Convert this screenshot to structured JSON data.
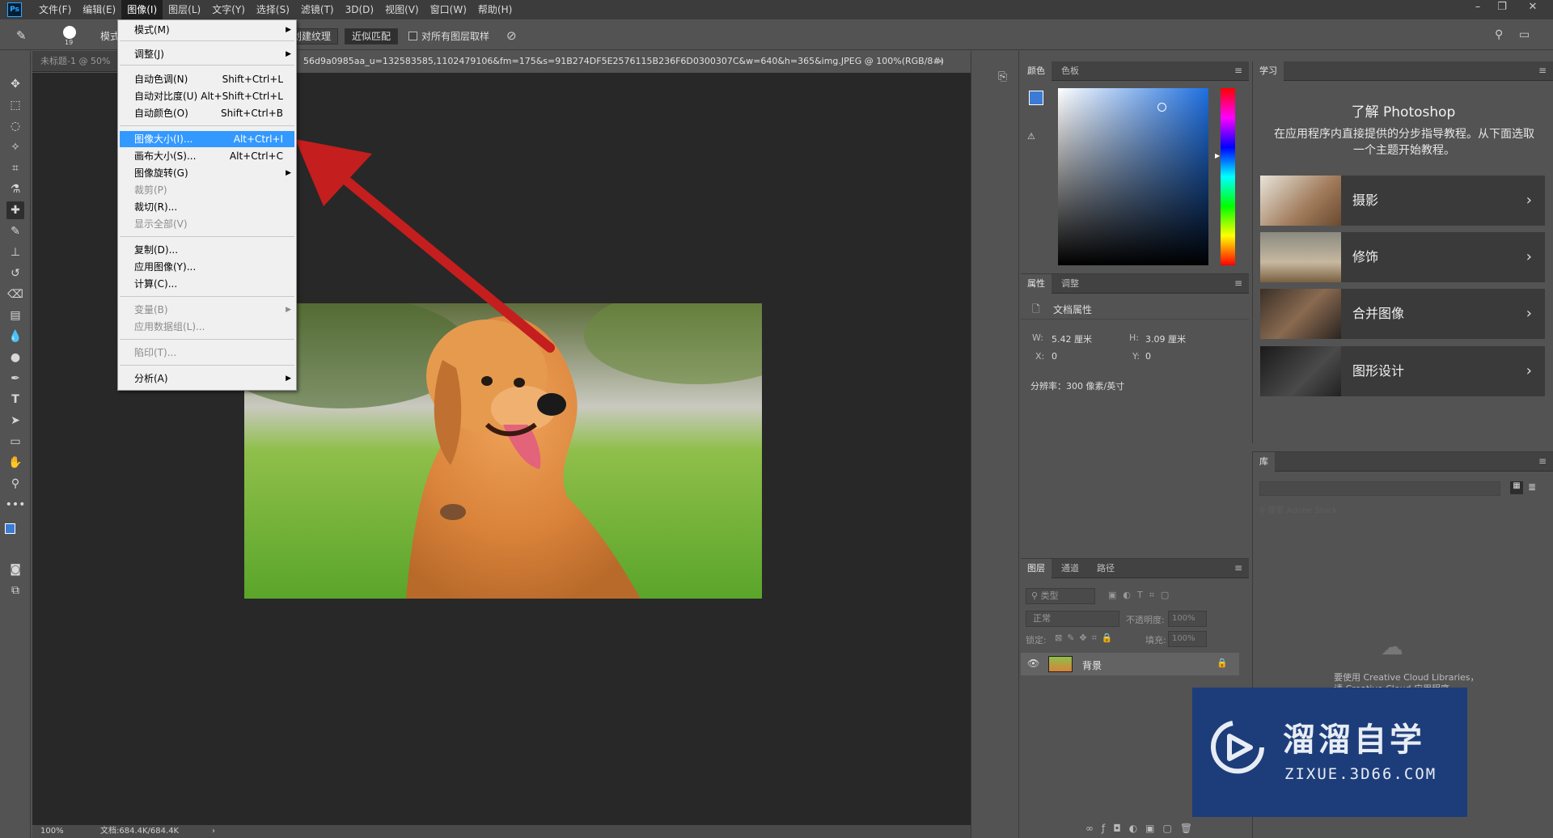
{
  "menubar": {
    "items": [
      "文件(F)",
      "编辑(E)",
      "图像(I)",
      "图层(L)",
      "文字(Y)",
      "选择(S)",
      "滤镜(T)",
      "3D(D)",
      "视图(V)",
      "窗口(W)",
      "帮助(H)"
    ],
    "active_index": 2
  },
  "options": {
    "brush_size": "19",
    "mode_label": "模式",
    "texture_btn": "创建纹理",
    "match_btn": "近似匹配",
    "sample_all": "对所有图层取样"
  },
  "tabs": {
    "first": "未标题-1 @ 50%",
    "second": "56d9a0985aa_u=132583585,1102479106&fm=175&s=91B274DF5E2576115B236F6D0300307C&w=640&h=365&img.JPEG @ 100%(RGB/8#)",
    "close": "×"
  },
  "dropdown": {
    "items": [
      {
        "label": "模式(M)",
        "shortcut": "",
        "submenu": true,
        "disabled": false
      },
      {
        "label": "调整(J)",
        "shortcut": "",
        "submenu": true,
        "disabled": false
      },
      {
        "label": "自动色调(N)",
        "shortcut": "Shift+Ctrl+L",
        "submenu": false,
        "disabled": false
      },
      {
        "label": "自动对比度(U)",
        "shortcut": "Alt+Shift+Ctrl+L",
        "submenu": false,
        "disabled": false
      },
      {
        "label": "自动颜色(O)",
        "shortcut": "Shift+Ctrl+B",
        "submenu": false,
        "disabled": false
      },
      {
        "label": "图像大小(I)...",
        "shortcut": "Alt+Ctrl+I",
        "submenu": false,
        "disabled": false
      },
      {
        "label": "画布大小(S)...",
        "shortcut": "Alt+Ctrl+C",
        "submenu": false,
        "disabled": false
      },
      {
        "label": "图像旋转(G)",
        "shortcut": "",
        "submenu": true,
        "disabled": false
      },
      {
        "label": "裁剪(P)",
        "shortcut": "",
        "submenu": false,
        "disabled": true
      },
      {
        "label": "裁切(R)...",
        "shortcut": "",
        "submenu": false,
        "disabled": false
      },
      {
        "label": "显示全部(V)",
        "shortcut": "",
        "submenu": false,
        "disabled": true
      },
      {
        "label": "复制(D)...",
        "shortcut": "",
        "submenu": false,
        "disabled": false
      },
      {
        "label": "应用图像(Y)...",
        "shortcut": "",
        "submenu": false,
        "disabled": false
      },
      {
        "label": "计算(C)...",
        "shortcut": "",
        "submenu": false,
        "disabled": false
      },
      {
        "label": "变量(B)",
        "shortcut": "",
        "submenu": true,
        "disabled": true
      },
      {
        "label": "应用数据组(L)...",
        "shortcut": "",
        "submenu": false,
        "disabled": true
      },
      {
        "label": "陷印(T)...",
        "shortcut": "",
        "submenu": false,
        "disabled": true
      },
      {
        "label": "分析(A)",
        "shortcut": "",
        "submenu": true,
        "disabled": false
      }
    ],
    "highlighted_index": 5
  },
  "color_panel": {
    "tabs": [
      "颜色",
      "色板"
    ],
    "fg_color": "#3a7bd5",
    "bg_color": "#ffffff"
  },
  "properties_panel": {
    "tabs": [
      "属性",
      "调整"
    ],
    "header": "文档属性",
    "w_label": "W:",
    "w_value": "5.42 厘米",
    "h_label": "H:",
    "h_value": "3.09 厘米",
    "x_label": "X:",
    "x_value": "0",
    "y_label": "Y:",
    "y_value": "0",
    "resolution": "分辨率：300 像素/英寸"
  },
  "layers_panel": {
    "tabs": [
      "图层",
      "通道",
      "路径"
    ],
    "filter_placeholder": "类型",
    "blend_mode": "正常",
    "opacity_label": "不透明度:",
    "opacity_value": "100%",
    "lock_label": "锁定:",
    "fill_label": "填充:",
    "fill_value": "100%",
    "layer_name": "背景"
  },
  "learn_panel": {
    "tab": "学习",
    "title": "了解 Photoshop",
    "desc": "在应用程序内直接提供的分步指导教程。从下面选取一个主题开始教程。",
    "cards": [
      "摄影",
      "修饰",
      "合并图像",
      "图形设计"
    ]
  },
  "library_panel": {
    "tab": "库",
    "search_placeholder": "搜索 Adobe Stock",
    "cc_text_1": "要使用 Creative Cloud Libraries，",
    "cc_text_2": "请 Creative Cloud 应用程序"
  },
  "watermark": {
    "title": "溜溜自学",
    "url": "ZIXUE.3D66.COM"
  },
  "status": {
    "zoom": "100%",
    "doc": "文档:684.4K/684.4K"
  }
}
